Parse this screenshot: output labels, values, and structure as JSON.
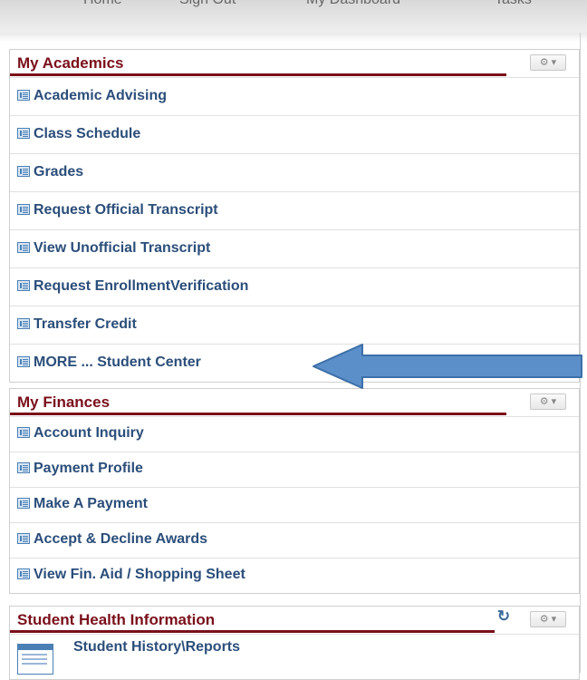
{
  "topnav": {
    "items": [
      "Home",
      "Sign Out",
      "My Dashboard",
      "Tasks"
    ]
  },
  "academics": {
    "title": "My Academics",
    "items": [
      "Academic Advising",
      "Class Schedule",
      "Grades",
      "Request Official Transcript",
      "View Unofficial Transcript",
      "Request EnrollmentVerification",
      "Transfer Credit",
      "MORE ... Student Center"
    ]
  },
  "finances": {
    "title": "My Finances",
    "items": [
      "Account Inquiry",
      "Payment Profile",
      "Make A Payment",
      "Accept & Decline Awards",
      "View Fin. Aid / Shopping Sheet"
    ]
  },
  "health": {
    "title": "Student Health Information",
    "items": [
      "Student History\\Reports"
    ]
  },
  "icons": {
    "list_item": "list-icon",
    "gear": "gear-icon",
    "refresh": "refresh-icon",
    "annotation": "arrow-left-icon"
  },
  "colors": {
    "header_text": "#7a0f1a",
    "link_text": "#2b4e7a",
    "arrow_fill": "#5b8fc9"
  }
}
